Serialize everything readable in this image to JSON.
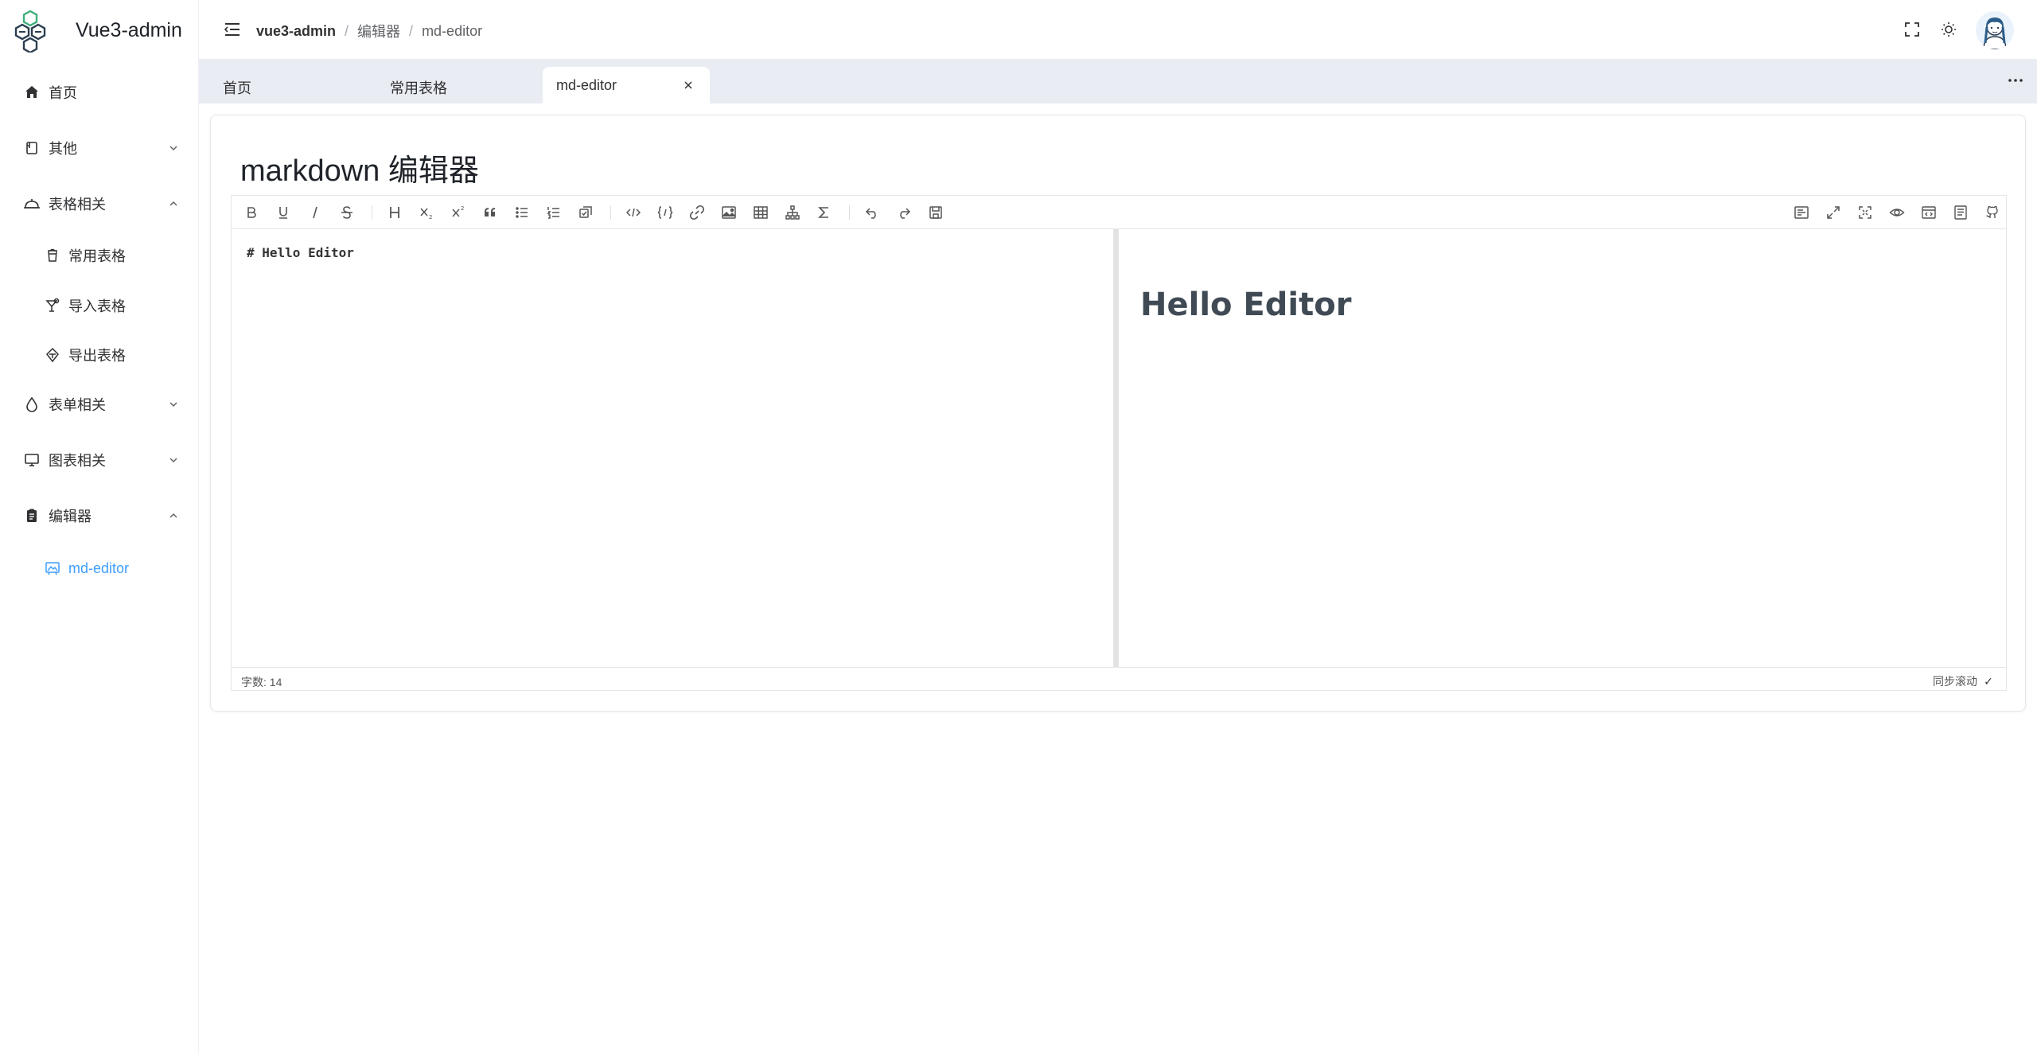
{
  "app": {
    "title": "Vue3-admin"
  },
  "sidebar": {
    "items": [
      {
        "label": "首页",
        "icon": "home-icon",
        "active": false
      },
      {
        "label": "其他",
        "icon": "document-icon",
        "expanded": false
      },
      {
        "label": "表格相关",
        "icon": "bell-icon",
        "expanded": true
      },
      {
        "label": "常用表格",
        "icon": "cup-icon"
      },
      {
        "label": "导入表格",
        "icon": "cocktail-icon"
      },
      {
        "label": "导出表格",
        "icon": "gem-icon"
      },
      {
        "label": "表单相关",
        "icon": "drop-icon",
        "expanded": false
      },
      {
        "label": "图表相关",
        "icon": "monitor-icon",
        "expanded": false
      },
      {
        "label": "编辑器",
        "icon": "clipboard-icon",
        "expanded": true
      },
      {
        "label": "md-editor",
        "icon": "picture-icon",
        "active": true
      }
    ]
  },
  "header": {
    "breadcrumb": [
      "vue3-admin",
      "编辑器",
      "md-editor"
    ],
    "breadcrumb_separator": "/"
  },
  "tabs": [
    {
      "label": "首页",
      "active": false
    },
    {
      "label": "常用表格",
      "active": false
    },
    {
      "label": "md-editor",
      "active": true,
      "closable": true
    }
  ],
  "page": {
    "title": "markdown 编辑器"
  },
  "editor": {
    "source": "# Hello Editor",
    "preview_heading": "Hello Editor",
    "word_count_label": "字数: 14",
    "sync_scroll_label": "同步滚动",
    "sync_scroll_checked": "✓",
    "toolbar_left": [
      "bold-icon",
      "underline-icon",
      "italic-icon",
      "strikethrough-icon",
      "title-icon",
      "subscript-icon",
      "superscript-icon",
      "quote-icon",
      "unordered-list-icon",
      "ordered-list-icon",
      "task-list-icon",
      "code-row-icon",
      "code-block-icon",
      "link-icon",
      "image-icon",
      "table-icon",
      "mermaid-icon",
      "formula-icon",
      "undo-icon",
      "redo-icon",
      "save-icon"
    ],
    "toolbar_right": [
      "prettier-icon",
      "page-fullscreen-icon",
      "fullscreen-icon",
      "preview-icon",
      "html-preview-icon",
      "catalog-icon",
      "github-icon"
    ]
  },
  "colors": {
    "accent": "#409eff",
    "tabs_bg": "#e9ecf3",
    "logo_teal": "#3eaf7c",
    "logo_dark": "#2c3e50"
  }
}
